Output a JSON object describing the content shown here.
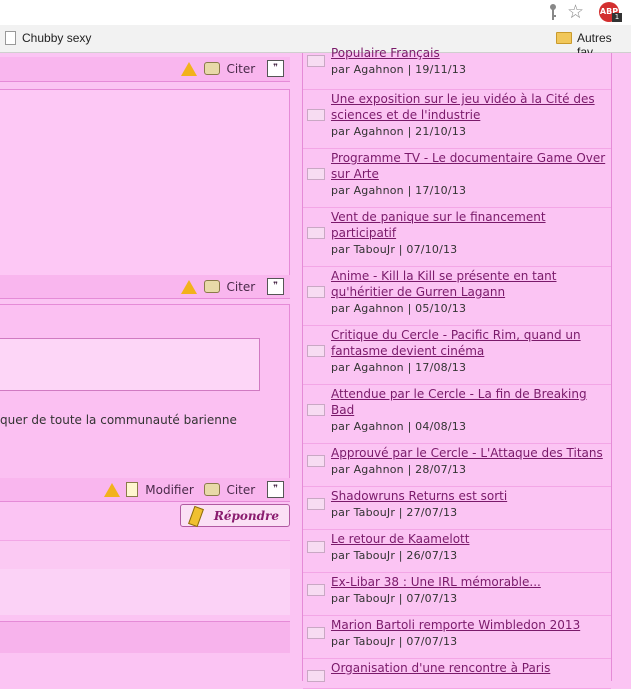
{
  "browser": {
    "bookmarks": [
      {
        "label": "Chubby sexy"
      },
      {
        "label": "Autres fav"
      }
    ],
    "abp_label": "ABP",
    "abp_badge": "1"
  },
  "forum": {
    "post1_actions": {
      "quote": "Citer"
    },
    "post2_actions": {
      "quote": "Citer"
    },
    "post3": {
      "text": "quer de toute la communauté barienne",
      "actions": {
        "edit": "Modifier",
        "quote": "Citer"
      }
    },
    "reply_label": "Répondre"
  },
  "news": [
    {
      "title": "Populaire Français",
      "author": "Agahnon",
      "date": "19/11/13"
    },
    {
      "title": "Une exposition sur le jeu vidéo à la Cité des sciences et de l'industrie",
      "author": "Agahnon",
      "date": "21/10/13"
    },
    {
      "title": "Programme TV - Le documentaire Game Over sur Arte",
      "author": "Agahnon",
      "date": "17/10/13"
    },
    {
      "title": "Vent de panique sur le financement participatif",
      "author": "TabouJr",
      "date": "07/10/13"
    },
    {
      "title": "Anime - Kill la Kill se présente en tant qu'héritier de Gurren Lagann",
      "author": "Agahnon",
      "date": "05/10/13"
    },
    {
      "title": "Critique du Cercle - Pacific Rim, quand un fantasme devient cinéma",
      "author": "Agahnon",
      "date": "17/08/13"
    },
    {
      "title": "Attendue par le Cercle - La fin de Breaking Bad",
      "author": "Agahnon",
      "date": "04/08/13"
    },
    {
      "title": "Approuvé par le Cercle - L'Attaque des Titans",
      "author": "Agahnon",
      "date": "28/07/13"
    },
    {
      "title": "Shadowruns Returns est sorti",
      "author": "TabouJr",
      "date": "27/07/13"
    },
    {
      "title": "Le retour de Kaamelott",
      "author": "TabouJr",
      "date": "26/07/13"
    },
    {
      "title": "Ex-Libar 38 : Une IRL mémorable...",
      "author": "TabouJr",
      "date": "07/07/13"
    },
    {
      "title": "Marion Bartoli remporte Wimbledon 2013",
      "author": "TabouJr",
      "date": "07/07/13"
    },
    {
      "title": "Organisation d'une rencontre à Paris",
      "author": "",
      "date": ""
    }
  ],
  "news_by_prefix": "par",
  "news_separator": "|",
  "colors": {
    "page_bg": "#fbc4f3",
    "link": "#7a1a6a",
    "border": "#e58bd7"
  }
}
